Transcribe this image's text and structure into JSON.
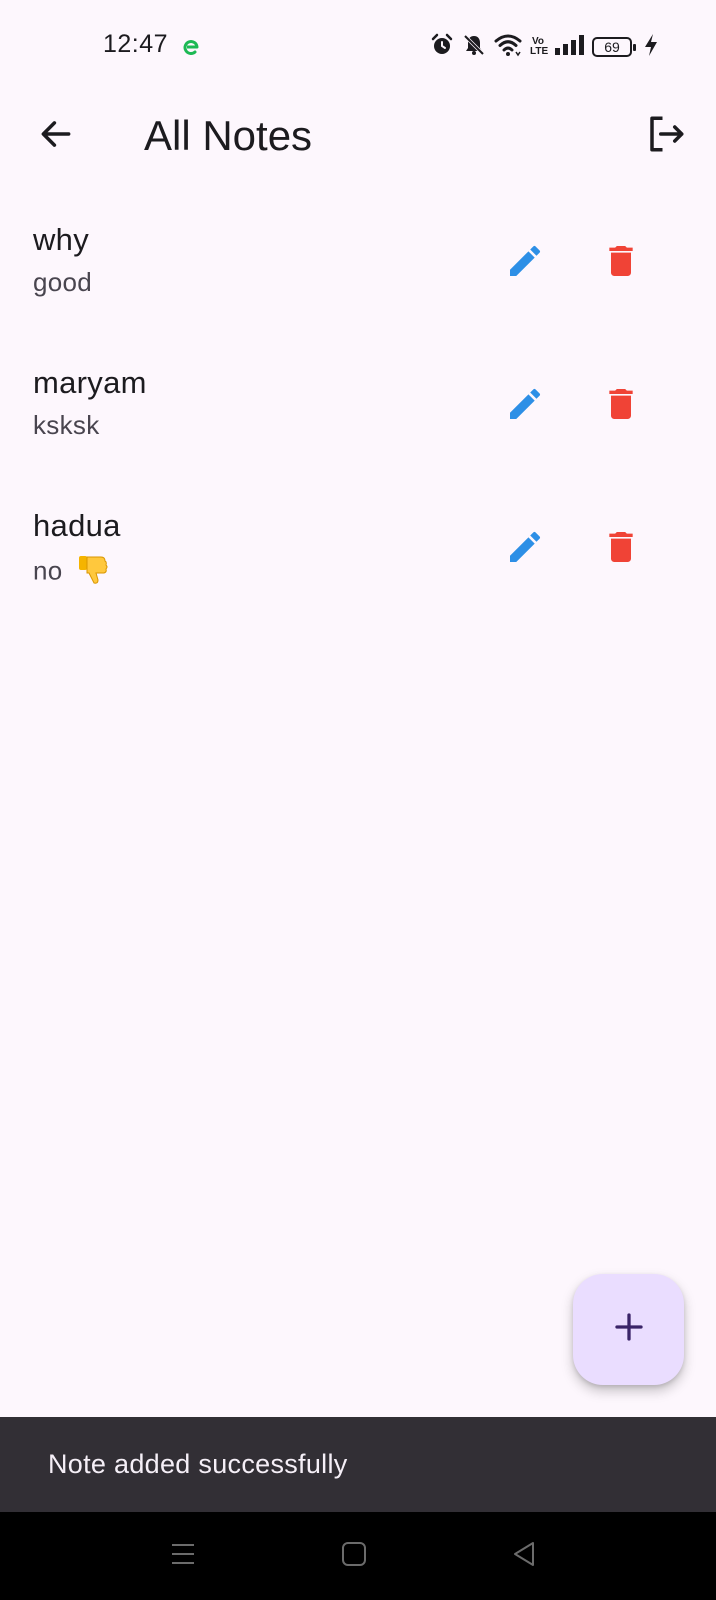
{
  "status_bar": {
    "time": "12:47",
    "battery_level": "69",
    "volte_label_top": "Vo",
    "volte_label_bottom": "LTE",
    "icons": [
      "app-notification-icon",
      "alarm-icon",
      "bell-off-icon",
      "wifi-icon",
      "volte-icon",
      "signal-icon",
      "battery-icon",
      "charging-icon"
    ]
  },
  "app_bar": {
    "title": "All Notes",
    "back_icon": "arrow-back-icon",
    "logout_icon": "logout-icon"
  },
  "notes": [
    {
      "title": "why",
      "body": "good"
    },
    {
      "title": "maryam",
      "body": "ksksk"
    },
    {
      "title": "hadua",
      "body": "no",
      "emoji": "thumbs-down-icon"
    }
  ],
  "note_actions": {
    "edit_icon": "pencil-icon",
    "delete_icon": "trash-icon"
  },
  "fab": {
    "icon": "plus-icon"
  },
  "snackbar": {
    "message": "Note added successfully"
  },
  "colors": {
    "background": "#FDF7FD",
    "edit": "#2D8FE6",
    "delete": "#F04336",
    "fab_bg": "#EADDFF",
    "fab_icon": "#3A2468",
    "snackbar_bg": "#322F35",
    "snackbar_text": "#F5EFF7",
    "app_icon_green": "#1DB954"
  },
  "nav_bar": {
    "icons": [
      "menu-icon",
      "home-icon",
      "back-triangle-icon"
    ]
  }
}
